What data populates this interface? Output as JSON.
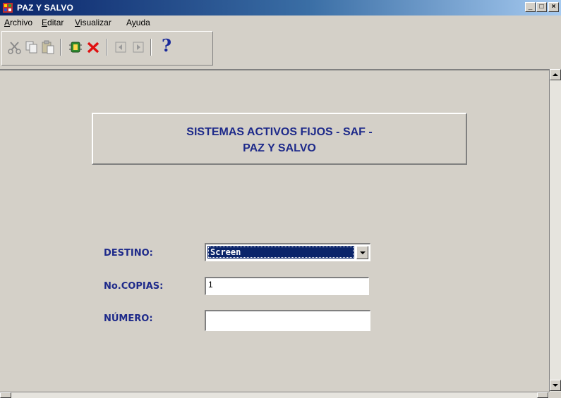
{
  "window": {
    "title": "PAZ Y SALVO"
  },
  "window_controls": {
    "minimize": "_",
    "maximize": "□",
    "close": "×"
  },
  "menu": [
    {
      "first": "A",
      "rest": "rchivo"
    },
    {
      "first": "E",
      "rest": "ditar"
    },
    {
      "first": "V",
      "rest": "isualizar"
    },
    {
      "prefix": "A",
      "first": "y",
      "rest": "uda"
    }
  ],
  "toolbar": {
    "icons": [
      "cut-icon",
      "copy-icon",
      "paste-icon",
      "run-icon",
      "cancel-icon",
      "previous-icon",
      "next-icon",
      "help-icon"
    ],
    "help_glyph": "?"
  },
  "banner": {
    "line1": "SISTEMAS ACTIVOS FIJOS - SAF -",
    "line2": "PAZ Y SALVO"
  },
  "form": {
    "destino_label": "DESTINO:",
    "destino_value": "Screen",
    "copias_label": "No.COPIAS:",
    "copias_value": "1",
    "numero_label": "NÚMERO:",
    "numero_value": ""
  },
  "colors": {
    "face": "#d4d0c8",
    "title_start": "#0a246a",
    "label_text": "#1e2a8a",
    "selection": "#0a246a"
  }
}
